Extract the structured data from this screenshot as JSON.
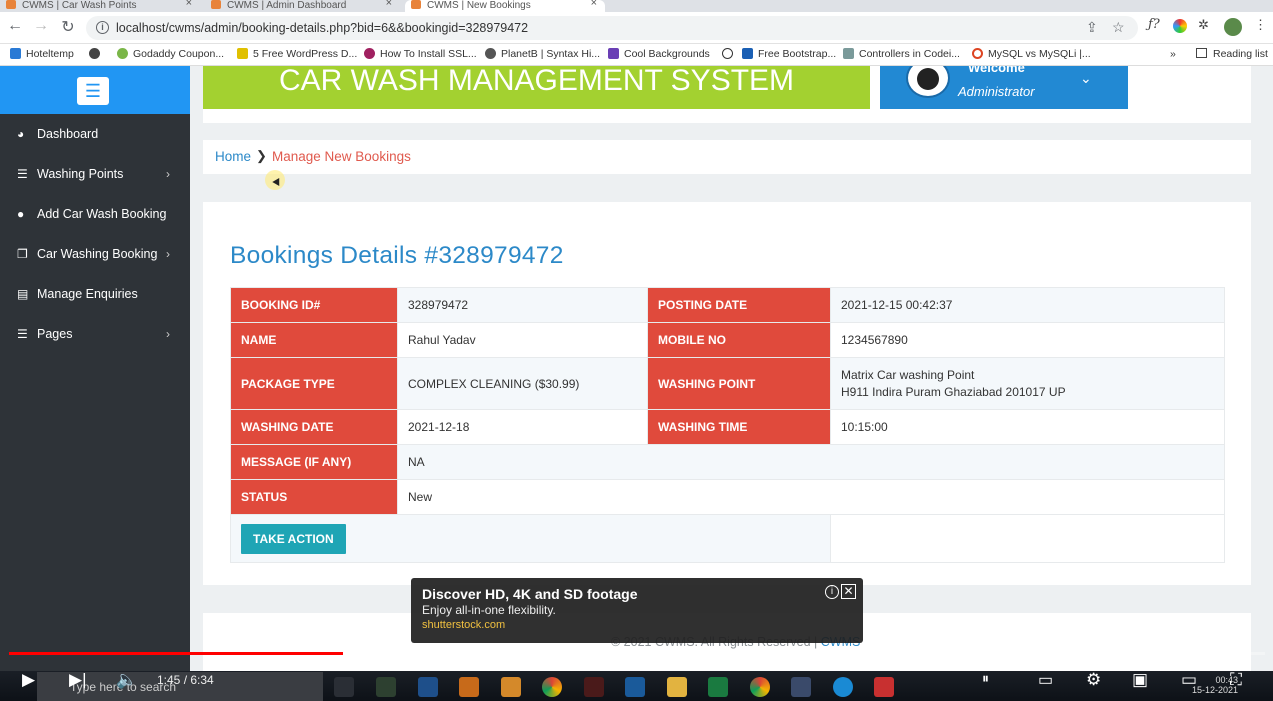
{
  "browser": {
    "tabs": [
      "CWMS | Car Wash Points",
      "CWMS | Admin Dashboard",
      "CWMS | New Bookings"
    ],
    "url": "localhost/cwms/admin/booking-details.php?bid=6&&bookingid=328979472",
    "reading_list": "Reading list"
  },
  "bookmarks": [
    "Hoteltemp",
    "Godaddy Coupon...",
    "5 Free WordPress D...",
    "How To Install SSL...",
    "PlanetB | Syntax Hi...",
    "Cool Backgrounds",
    "Free Bootstrap...",
    "Controllers in Codei...",
    "MySQL vs MySQLi |..."
  ],
  "sidebar": {
    "items": [
      {
        "label": "Dashboard",
        "icon": "dashboard-icon"
      },
      {
        "label": "Washing Points",
        "icon": "list-icon"
      },
      {
        "label": "Add Car Wash Booking",
        "icon": "user-icon"
      },
      {
        "label": "Car Washing Booking",
        "icon": "copy-icon"
      },
      {
        "label": "Manage Enquiries",
        "icon": "file-icon"
      },
      {
        "label": "Pages",
        "icon": "list-icon"
      }
    ]
  },
  "header": {
    "banner": "CAR WASH MANAGEMENT SYSTEM",
    "welcome": "Welcome",
    "role": "Administrator"
  },
  "breadcrumb": {
    "home": "Home",
    "current": "Manage New Bookings"
  },
  "booking": {
    "title": "Bookings Details #328979472",
    "labels": {
      "booking_id": "BOOKING ID#",
      "posting_date": "POSTING DATE",
      "name": "NAME",
      "mobile_no": "MOBILE NO",
      "package_type": "PACKAGE TYPE",
      "washing_point": "WASHING POINT",
      "washing_date": "WASHING DATE",
      "washing_time": "WASHING TIME",
      "message": "MESSAGE (IF ANY)",
      "status": "STATUS"
    },
    "values": {
      "booking_id": "328979472",
      "posting_date": "2021-12-15 00:42:37",
      "name": "Rahul Yadav",
      "mobile_no": "1234567890",
      "package_type": "COMPLEX CLEANING ($30.99)",
      "washing_point_name": "Matrix Car washing Point",
      "washing_point_address": "H911 Indira Puram Ghaziabad 201017 UP",
      "washing_date": "2021-12-18",
      "washing_time": "10:15:00",
      "message": "NA",
      "status": "New"
    },
    "action_button": "TAKE ACTION"
  },
  "footer": {
    "text": "© 2021 CWMS. All Rights Reserved | ",
    "link": "CWMS"
  },
  "ad": {
    "title": "Discover HD, 4K and SD footage",
    "subtitle": "Enjoy all-in-one flexibility.",
    "domain": "shutterstock.com"
  },
  "video": {
    "current": "1:45",
    "duration": "6:34",
    "played_fraction": 0.266,
    "buffered_fraction": 0.329
  },
  "taskbar": {
    "search_placeholder": "Type here to search",
    "time": "00:43",
    "date": "15-12-2021"
  },
  "colors": {
    "sidebar": "#2e3338",
    "accent_blue": "#2196f3",
    "banner_green": "#a3d130",
    "label_red": "#e04a3c",
    "button_teal": "#1fa5b5",
    "progress_red": "#ff0000"
  }
}
